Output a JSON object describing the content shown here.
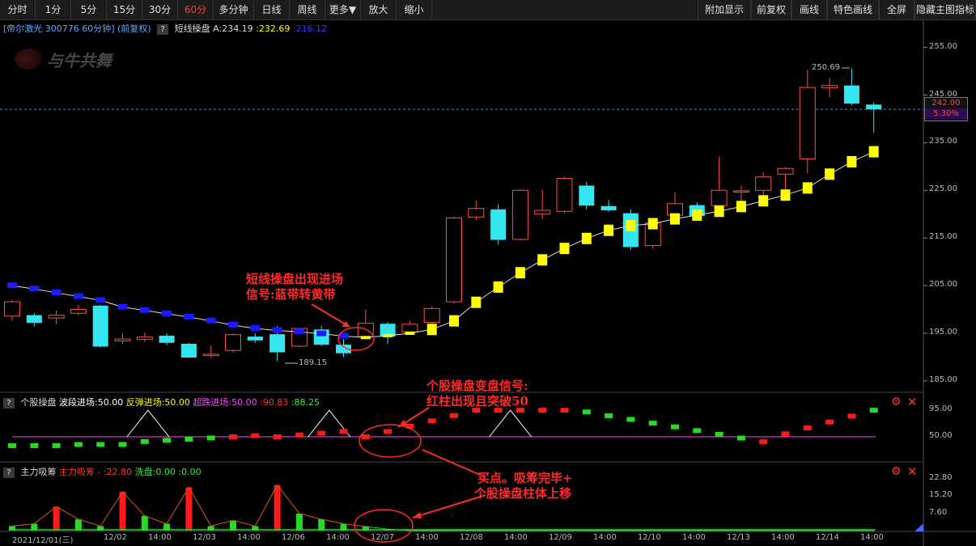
{
  "toolbar": {
    "left": [
      "分时",
      "1分",
      "5分",
      "15分",
      "30分",
      "60分",
      "多分钟",
      "日线",
      "周线",
      "更多▼",
      "放大",
      "缩小"
    ],
    "active_index": 5,
    "right": [
      "附加显示",
      "前复权",
      "画线",
      "特色画线",
      "全屏",
      "隐藏主图指标"
    ]
  },
  "main_header": {
    "stock": "[帝尔激光 300776 60分钟] (前复权)",
    "q": "?",
    "indicator": "短线操盘",
    "a_label": "A:234.19",
    "v2": ":232.69",
    "v3": ":216.12"
  },
  "watermark": "与牛共舞",
  "price_axis": [
    "255.00",
    "245.00",
    "235.00",
    "225.00",
    "215.00",
    "205.00",
    "195.00",
    "185.00"
  ],
  "price_tag": {
    "price": "242.00",
    "pct": "5.30%"
  },
  "marks": {
    "high": "250.69",
    "low": "189.15"
  },
  "sub1_header": {
    "q": "?",
    "name": "个股操盘",
    "l1": "波段进场:50.00",
    "l2": "反弹进场:50.00",
    "l3": "超跌进场:50.00",
    "v1": ":90.83",
    "v2": ":88.25"
  },
  "sub1_axis": [
    "95.00",
    "50.00"
  ],
  "sub2_header": {
    "q": "?",
    "name": "主力吸筹",
    "l1": "主力吸筹 -",
    "v1": ":22.80",
    "l2": "洗盘:0.00",
    "v2": ":0.00"
  },
  "sub2_axis": [
    "22.80",
    "15.20",
    "7.60"
  ],
  "time_axis": [
    "2021/12/01(三)",
    "12/02",
    "14:00",
    "12/03",
    "14:00",
    "12/06",
    "14:00",
    "12/07",
    "14:00",
    "12/08",
    "14:00",
    "12/09",
    "14:00",
    "12/10",
    "14:00",
    "12/13",
    "14:00",
    "12/14",
    "14:00"
  ],
  "annotations": {
    "a1_l1": "短线操盘出现进场",
    "a1_l2": "信号:蓝带转黄带",
    "a2_l1": "个股操盘变盘信号:",
    "a2_l2": "红柱出现且突破50",
    "a3_l1": "买点。吸筹完毕+",
    "a3_l2": "个股操盘柱体上移"
  },
  "colors": {
    "up": "#ff4d4d",
    "down": "#33e6f0",
    "band_yellow": "#ffff00",
    "band_blue": "#1a1aff",
    "sub_up": "#ff1a1a",
    "sub_down": "#22dd22",
    "annot": "#ff2a2a"
  },
  "chart_data": {
    "type": "candlestick",
    "ylim": [
      185,
      255
    ],
    "candles": [
      {
        "o": 198.6,
        "c": 201.6,
        "h": 202.0,
        "l": 197.6
      },
      {
        "o": 198.8,
        "c": 197.2,
        "h": 199.2,
        "l": 196.4
      },
      {
        "o": 198.2,
        "c": 198.8,
        "h": 199.8,
        "l": 196.9
      },
      {
        "o": 199.2,
        "c": 200.0,
        "h": 201.0,
        "l": 198.8
      },
      {
        "o": 200.8,
        "c": 192.2,
        "h": 201.0,
        "l": 192.0
      },
      {
        "o": 193.4,
        "c": 193.8,
        "h": 195.0,
        "l": 192.8
      },
      {
        "o": 193.7,
        "c": 194.2,
        "h": 195.1,
        "l": 193.2
      },
      {
        "o": 194.5,
        "c": 193.0,
        "h": 195.0,
        "l": 192.5
      },
      {
        "o": 192.8,
        "c": 189.9,
        "h": 193.0,
        "l": 189.8
      },
      {
        "o": 190.3,
        "c": 190.6,
        "h": 192.4,
        "l": 189.9
      },
      {
        "o": 191.4,
        "c": 194.7,
        "h": 195.0,
        "l": 191.0
      },
      {
        "o": 194.3,
        "c": 193.5,
        "h": 195.0,
        "l": 193.0
      },
      {
        "o": 194.8,
        "c": 191.0,
        "h": 196.5,
        "l": 189.2
      },
      {
        "o": 192.3,
        "c": 196.0,
        "h": 196.0,
        "l": 192.0
      },
      {
        "o": 195.8,
        "c": 192.6,
        "h": 196.6,
        "l": 192.3
      },
      {
        "o": 192.6,
        "c": 190.8,
        "h": 193.8,
        "l": 190.0
      },
      {
        "o": 194.3,
        "c": 197.1,
        "h": 200.0,
        "l": 193.8
      },
      {
        "o": 197.0,
        "c": 194.3,
        "h": 197.4,
        "l": 192.8
      },
      {
        "o": 195.3,
        "c": 196.9,
        "h": 197.6,
        "l": 194.8
      },
      {
        "o": 197.3,
        "c": 200.2,
        "h": 200.7,
        "l": 196.8
      },
      {
        "o": 201.6,
        "c": 219.2,
        "h": 219.5,
        "l": 201.2
      },
      {
        "o": 219.4,
        "c": 221.2,
        "h": 222.8,
        "l": 218.8
      },
      {
        "o": 221.0,
        "c": 214.6,
        "h": 222.1,
        "l": 213.6
      },
      {
        "o": 214.7,
        "c": 225.0,
        "h": 225.2,
        "l": 214.5
      },
      {
        "o": 220.0,
        "c": 220.8,
        "h": 225.1,
        "l": 219.0
      },
      {
        "o": 220.6,
        "c": 227.5,
        "h": 227.8,
        "l": 220.2
      },
      {
        "o": 226.0,
        "c": 221.8,
        "h": 226.8,
        "l": 221.0
      },
      {
        "o": 221.7,
        "c": 220.8,
        "h": 223.0,
        "l": 220.5
      },
      {
        "o": 220.2,
        "c": 213.1,
        "h": 221.0,
        "l": 212.5
      },
      {
        "o": 213.4,
        "c": 218.1,
        "h": 218.6,
        "l": 212.8
      },
      {
        "o": 219.8,
        "c": 222.2,
        "h": 224.6,
        "l": 219.4
      },
      {
        "o": 221.9,
        "c": 219.6,
        "h": 222.5,
        "l": 219.0
      },
      {
        "o": 221.8,
        "c": 225.0,
        "h": 232.0,
        "l": 221.4
      },
      {
        "o": 224.7,
        "c": 224.9,
        "h": 226.0,
        "l": 222.5
      },
      {
        "o": 225.0,
        "c": 227.8,
        "h": 228.8,
        "l": 223.9
      },
      {
        "o": 228.4,
        "c": 229.6,
        "h": 229.9,
        "l": 224.8
      },
      {
        "o": 231.6,
        "c": 246.6,
        "h": 250.3,
        "l": 228.6
      },
      {
        "o": 246.5,
        "c": 247.0,
        "h": 248.6,
        "l": 244.6
      },
      {
        "o": 247.0,
        "c": 243.2,
        "h": 250.6,
        "l": 242.8
      },
      {
        "o": 243.0,
        "c": 242.0,
        "h": 243.5,
        "l": 237.1
      }
    ],
    "band": [
      205,
      204.3,
      203.5,
      202.7,
      201.9,
      200.5,
      199.8,
      199.1,
      198.4,
      197.6,
      196.7,
      196.0,
      195.6,
      195.3,
      194.9,
      194.4,
      194.1,
      194.5,
      195.0,
      195.8,
      197.6,
      201.5,
      204.7,
      207.7,
      210.4,
      212.8,
      214.9,
      216.6,
      217.6,
      218.0,
      219.0,
      219.8,
      220.6,
      221.6,
      222.8,
      224.0,
      225.5,
      228.4,
      231.0,
      233.1
    ],
    "band_yellow_from": 16,
    "sub1": {
      "ylim": [
        30,
        100
      ],
      "ref": 50,
      "peaks_x": [
        3,
        7,
        11
      ],
      "bars": [
        -35,
        -36,
        -36,
        -37,
        -37,
        -38,
        -38,
        -39,
        -38,
        -37,
        -37,
        -36,
        -35,
        -33,
        -31,
        -29,
        -27,
        -25,
        -23,
        -21,
        -20,
        -23,
        -22,
        -22,
        -22,
        -22,
        -22,
        -22,
        -22,
        -22,
        -22,
        -22,
        -22,
        -22,
        -22,
        -22,
        -22,
        -22,
        -22,
        -22
      ]
    },
    "sub2": {
      "ylim": [
        0,
        22.8
      ],
      "red": [
        0,
        0,
        10.5,
        0,
        0,
        17,
        0,
        0,
        19,
        0,
        0,
        0,
        20,
        0,
        0,
        0,
        0,
        0,
        0,
        0,
        0,
        0,
        0,
        0,
        0,
        0,
        0,
        0,
        0,
        0,
        0,
        0,
        0,
        0,
        0,
        0,
        0,
        0,
        0,
        0
      ],
      "green": [
        2,
        3,
        0,
        5,
        2,
        0,
        6.5,
        3,
        0,
        2,
        4.5,
        2,
        0,
        7.5,
        5,
        3,
        1.8,
        0.6,
        0,
        0,
        0,
        0,
        0,
        0,
        0,
        0,
        0,
        0,
        0,
        0,
        0,
        0,
        0,
        0,
        0,
        0,
        0,
        0,
        0,
        0
      ]
    }
  }
}
